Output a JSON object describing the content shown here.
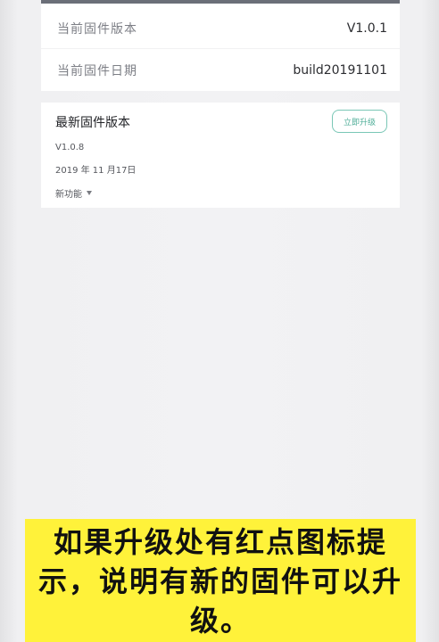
{
  "current_firmware": {
    "version_label": "当前固件版本",
    "version_value": "V1.0.1",
    "date_label": "当前固件日期",
    "date_value": "build20191101"
  },
  "latest_firmware": {
    "title": "最新固件版本",
    "upgrade_button_label": "立即升级",
    "version": "V1.0.8",
    "date": "2019 年 11 月17日",
    "features_label": "新功能"
  },
  "caption": {
    "text": "如果升级处有红点图标提示，说明有新的固件可以升级。"
  },
  "colors": {
    "accent": "#4fae98",
    "caption_bg": "#fff23a"
  },
  "icons": [
    "chevron-down-icon"
  ]
}
